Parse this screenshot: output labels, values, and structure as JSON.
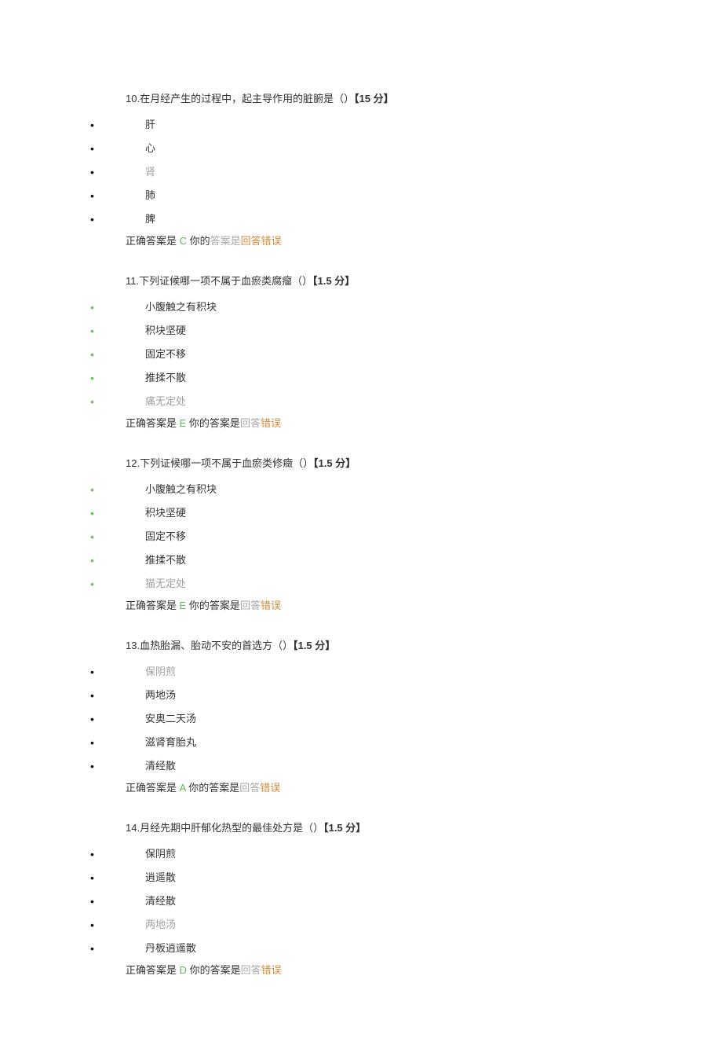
{
  "questions": [
    {
      "number": "10.",
      "stem": "在月经产生的过程中，起主导作用的脏腑是（）",
      "score_label": "【15 分】",
      "bullet_style": "black",
      "options": [
        {
          "text": "肝",
          "selected": false
        },
        {
          "text": "心",
          "selected": false
        },
        {
          "text": "肾",
          "selected": true
        },
        {
          "text": "肺",
          "selected": false
        },
        {
          "text": "脾",
          "selected": false
        }
      ],
      "answer": {
        "prefix": "正确答案是",
        "letter": "C",
        "your_part1": " 你的",
        "your_part2_grey": "答案是",
        "result_orange": "回答错误"
      }
    },
    {
      "number": "11.",
      "stem": "下列证候哪一项不属于血瘀类腐瘤（）",
      "score_label": "【1.5 分】",
      "bullet_style": "green",
      "options": [
        {
          "text": "小腹触之有积块",
          "selected": false
        },
        {
          "text": "积块坚硬",
          "selected": false
        },
        {
          "text": "固定不移",
          "selected": false
        },
        {
          "text": "推揉不散",
          "selected": false
        },
        {
          "text": "痛无定处",
          "selected": true
        }
      ],
      "answer": {
        "prefix": "正确答案是",
        "letter": "E",
        "your_part1": " 你的答案是",
        "your_part2_grey": "回答",
        "result_orange": "错误"
      }
    },
    {
      "number": "12.",
      "stem": "下列证候哪一项不属于血瘀类修癥（）",
      "score_label": "【1.5 分】",
      "bullet_style": "green",
      "options": [
        {
          "text": "小腹触之有积块",
          "selected": false
        },
        {
          "text": "积块坚硬",
          "selected": false
        },
        {
          "text": "固定不移",
          "selected": false
        },
        {
          "text": "推揉不散",
          "selected": false
        },
        {
          "text": "猫无定处",
          "selected": true
        }
      ],
      "answer": {
        "prefix": "正确答案是",
        "letter": "E",
        "your_part1": " 你的答案是",
        "your_part2_grey": "回答",
        "result_orange": "错误"
      }
    },
    {
      "number": "13.",
      "stem": "血热胎漏、胎动不安的首选方（）",
      "score_label": "【1.5 分】",
      "bullet_style": "black",
      "options": [
        {
          "text": "保阴煎",
          "selected": true
        },
        {
          "text": "两地汤",
          "selected": false
        },
        {
          "text": "安奥二天汤",
          "selected": false
        },
        {
          "text": "滋肾育胎丸",
          "selected": false
        },
        {
          "text": "清经散",
          "selected": false
        }
      ],
      "answer": {
        "prefix": "正确答案是",
        "letter": "A",
        "your_part1": " 你的答案是",
        "your_part2_grey": "回答",
        "result_orange": "错误"
      }
    },
    {
      "number": "14.",
      "stem": "月经先期中肝郁化热型的最佳处方是（）",
      "score_label": "【1.5 分】",
      "bullet_style": "black",
      "options": [
        {
          "text": "保阴煎",
          "selected": false
        },
        {
          "text": "逍遥散",
          "selected": false
        },
        {
          "text": "清经散",
          "selected": false
        },
        {
          "text": "两地汤",
          "selected": true
        },
        {
          "text": "丹板逍遥散",
          "selected": false
        }
      ],
      "answer": {
        "prefix": "正确答案是",
        "letter": "D",
        "your_part1": " 你的答案是",
        "your_part2_grey": "回答",
        "result_orange": "错误"
      }
    }
  ]
}
